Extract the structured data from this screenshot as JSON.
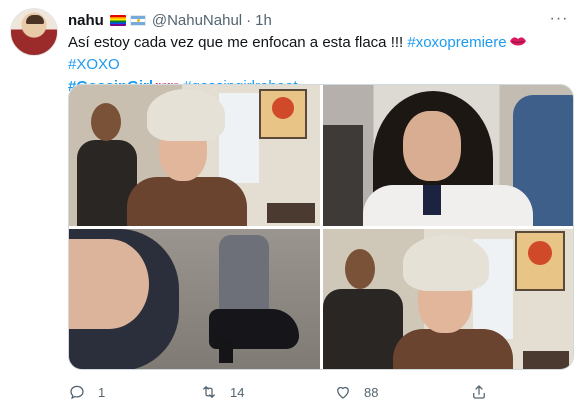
{
  "tweet": {
    "author_name": "nahu",
    "author_handle": "@NahuNahul",
    "separator": "·",
    "time": "1h",
    "more_label": "···",
    "text_main": "Así estoy cada vez que me enfocan a esta flaca !!! ",
    "hashtags": [
      "#xoxopremiere",
      "#XOXO",
      "#GossipGirl",
      "#gossipgirlreboot"
    ],
    "hashflag_text": "XOXO"
  },
  "media": {
    "count": 4
  },
  "actions": {
    "reply_count": "1",
    "retweet_count": "14",
    "like_count": "88"
  },
  "colors": {
    "link": "#1d9bf0",
    "text": "#0f1419",
    "muted": "#536471",
    "border": "#cfd9de"
  },
  "icons": {
    "reply": "reply-icon",
    "retweet": "retweet-icon",
    "like": "heart-icon",
    "share": "share-icon",
    "more": "more-icon",
    "lips": "lips-icon"
  }
}
